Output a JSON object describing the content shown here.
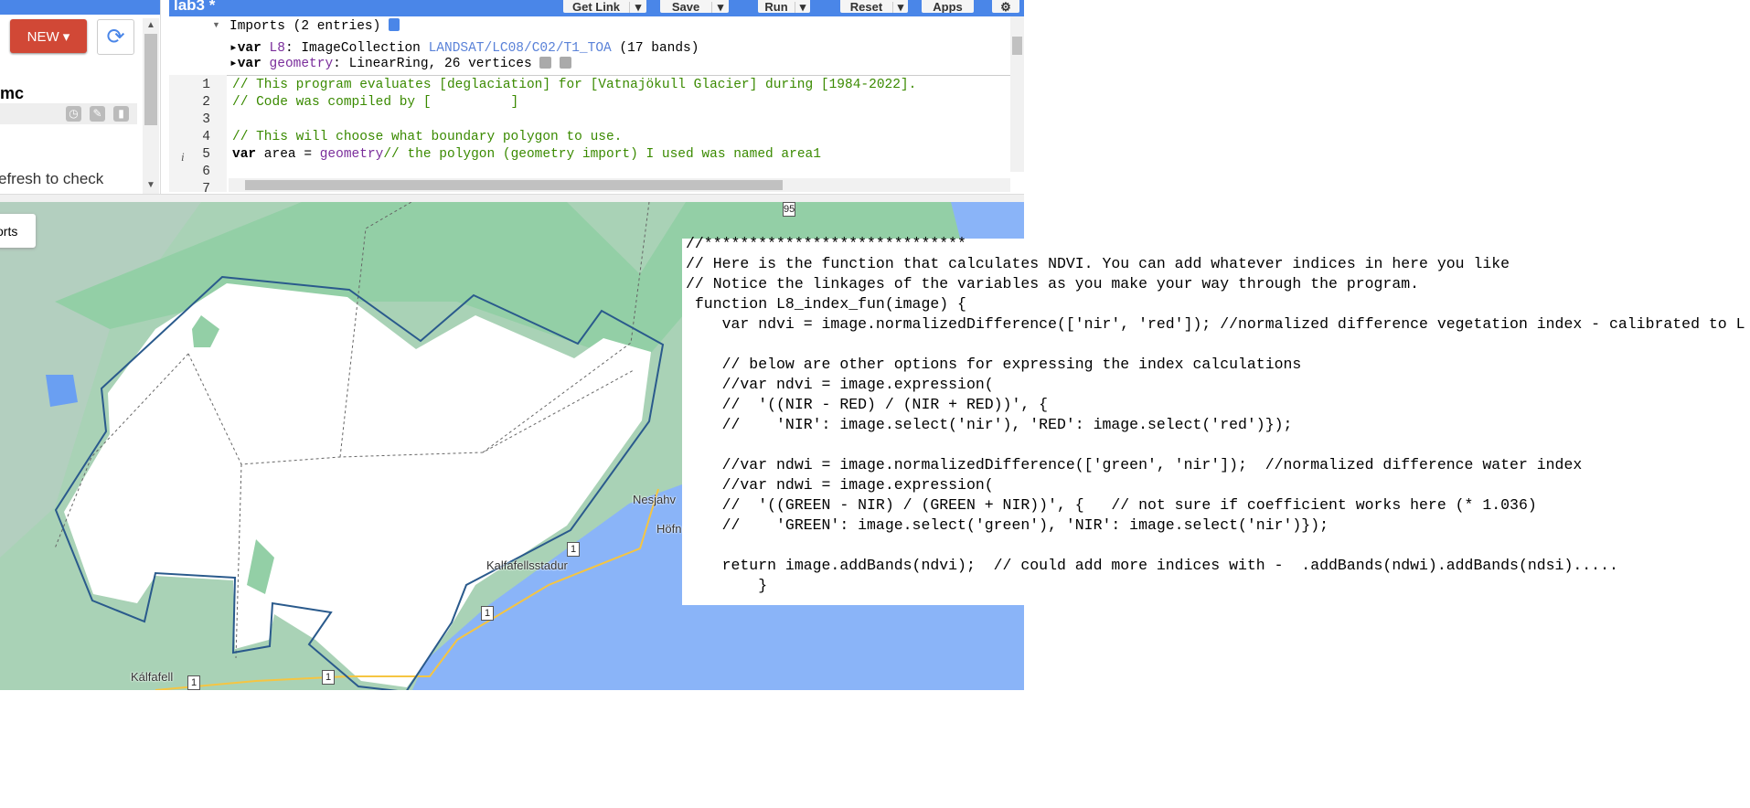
{
  "left_panel": {
    "new_label": "NEW ▾",
    "repo_name": "mc",
    "hint": "efresh to check",
    "imports_label": "orts"
  },
  "header": {
    "title": "lab3 *",
    "buttons": [
      {
        "label": "Get Link"
      },
      {
        "label": "Save"
      },
      {
        "label": "Run"
      },
      {
        "label": "Reset"
      },
      {
        "label": "Apps"
      }
    ]
  },
  "imports": {
    "header": "Imports (2 entries)",
    "l8": {
      "kw": "var",
      "name": "L8",
      "type": ": ImageCollection ",
      "link": "LANDSAT/LC08/C02/T1_TOA",
      "rest": " (17 bands)"
    },
    "geometry": {
      "kw": "var",
      "name": "geometry",
      "type": ": LinearRing, 26 vertices"
    }
  },
  "code": {
    "lines": [
      {
        "n": "1",
        "text": "// This program evaluates [deglaciation] for [Vatnajökull Glacier] during [1984-2022]."
      },
      {
        "n": "2",
        "text": "// Code was compiled by [          ]"
      },
      {
        "n": "3",
        "text": ""
      },
      {
        "n": "4",
        "text": "// This will choose what boundary polygon to use."
      },
      {
        "n": "5",
        "kw": "var",
        "mid": " area = ",
        "var": "geometry",
        "comment": "// the polygon (geometry import) I used was named area1"
      },
      {
        "n": "6",
        "text": ""
      },
      {
        "n": "7",
        "text": ""
      }
    ]
  },
  "map": {
    "labels": [
      "Nesjahv",
      "Höfn",
      "Kalfafellsstadur",
      "Kálfafell"
    ],
    "shields": [
      "95",
      "1",
      "1",
      "1",
      "1"
    ],
    "colors": {
      "land": "#a8d5b4",
      "forest": "#94d2a5",
      "ice": "#ffffff",
      "water": "#8ab4f8",
      "outline": "#2a5a8c"
    }
  },
  "overlay_code": [
    "//*****************************",
    "// Here is the function that calculates NDVI. You can add whatever indices in here you like",
    "// Notice the linkages of the variables as you make your way through the program.",
    " function L8_index_fun(image) {",
    "    var ndvi = image.normalizedDifference(['nir', 'red']); //normalized difference vegetation index - calibrated to L",
    "",
    "    // below are other options for expressing the index calculations",
    "    //var ndvi = image.expression(",
    "    //  '((NIR - RED) / (NIR + RED))', {",
    "    //    'NIR': image.select('nir'), 'RED': image.select('red')});",
    "",
    "    //var ndwi = image.normalizedDifference(['green', 'nir']);  //normalized difference water index",
    "    //var ndwi = image.expression(",
    "    //  '((GREEN - NIR) / (GREEN + NIR))', {   // not sure if coefficient works here (* 1.036)",
    "    //    'GREEN': image.select('green'), 'NIR': image.select('nir')});",
    "",
    "    return image.addBands(ndvi);  // could add more indices with -  .addBands(ndwi).addBands(ndsi).....",
    "        }"
  ]
}
